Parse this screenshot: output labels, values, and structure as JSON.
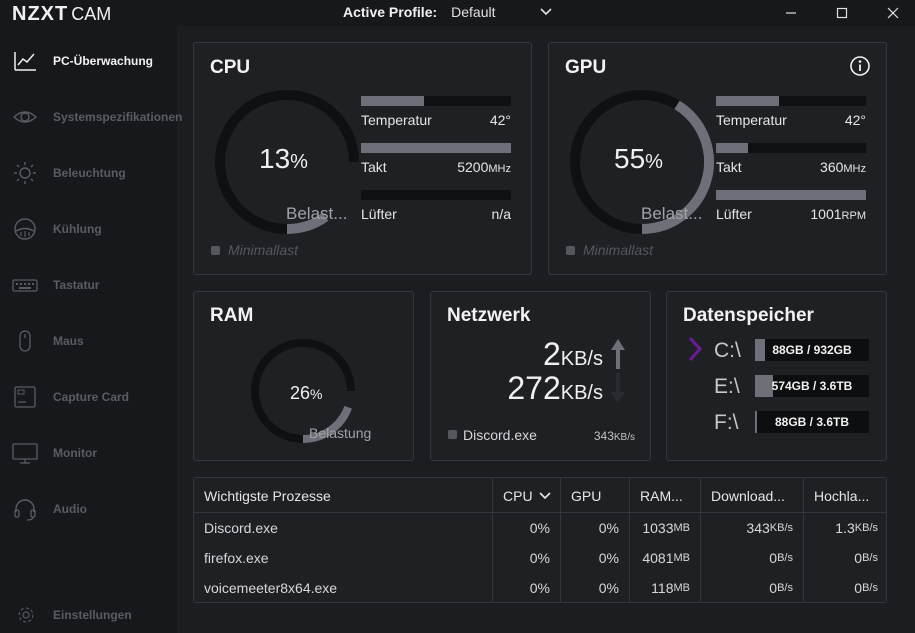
{
  "app": {
    "logo_main": "NZXT",
    "logo_sub": "CAM"
  },
  "header": {
    "profile_label": "Active Profile:",
    "profile_value": "Default"
  },
  "sidebar": {
    "items": [
      {
        "label": "PC-Überwachung",
        "icon": "line-chart-icon",
        "active": true
      },
      {
        "label": "Systemspezifikationen",
        "icon": "eye-icon"
      },
      {
        "label": "Beleuchtung",
        "icon": "sun-icon"
      },
      {
        "label": "Kühlung",
        "icon": "cooler-icon"
      },
      {
        "label": "Tastatur",
        "icon": "keyboard-icon"
      },
      {
        "label": "Maus",
        "icon": "mouse-icon"
      },
      {
        "label": "Capture Card",
        "icon": "capture-card-icon"
      },
      {
        "label": "Monitor",
        "icon": "monitor-icon"
      },
      {
        "label": "Audio",
        "icon": "headset-icon"
      }
    ],
    "settings_label": "Einstellungen"
  },
  "cpu": {
    "title": "CPU",
    "load_value": "13",
    "load_unit": "%",
    "load_fraction": 0.13,
    "load_label": "Belast...",
    "minimal_label": "Minimallast",
    "stats": [
      {
        "label": "Temperatur",
        "value": "42",
        "unit": "°",
        "fill": 0.42
      },
      {
        "label": "Takt",
        "value": "5200",
        "unit": "MHz",
        "fill": 1.0
      },
      {
        "label": "Lüfter",
        "value": "n/a",
        "unit": "",
        "fill": 0.0
      }
    ]
  },
  "gpu": {
    "title": "GPU",
    "load_value": "55",
    "load_unit": "%",
    "load_fraction": 0.55,
    "load_label": "Belast...",
    "minimal_label": "Minimallast",
    "stats": [
      {
        "label": "Temperatur",
        "value": "42",
        "unit": "°",
        "fill": 0.42
      },
      {
        "label": "Takt",
        "value": "360",
        "unit": "MHz",
        "fill": 0.21
      },
      {
        "label": "Lüfter",
        "value": "1001",
        "unit": "RPM",
        "fill": 1.0
      }
    ]
  },
  "ram": {
    "title": "RAM",
    "load_value": "26",
    "load_unit": "%",
    "load_fraction": 0.26,
    "load_label": "Belastung"
  },
  "network": {
    "title": "Netzwerk",
    "upload_value": "2",
    "download_value": "272",
    "unit": "KB/s",
    "top_process": "Discord.exe",
    "top_process_value": "343",
    "top_process_unit": "KB/s"
  },
  "storage": {
    "title": "Datenspeicher",
    "drives": [
      {
        "letter": "C:\\",
        "usage": "88GB / 932GB",
        "fill": 0.09,
        "selected": true
      },
      {
        "letter": "E:\\",
        "usage": "574GB / 3.6TB",
        "fill": 0.16
      },
      {
        "letter": "F:\\",
        "usage": "88GB / 3.6TB",
        "fill": 0.02
      }
    ]
  },
  "processes": {
    "columns": [
      "Wichtigste Prozesse",
      "CPU",
      "GPU",
      "RAM...",
      "Download...",
      "Hochla..."
    ],
    "rows": [
      {
        "name": "Discord.exe",
        "cpu": "0%",
        "gpu": "0%",
        "ram": "1033",
        "ram_unit": "MB",
        "down": "343",
        "down_unit": "KB/s",
        "up": "1.3",
        "up_unit": "KB/s"
      },
      {
        "name": "firefox.exe",
        "cpu": "0%",
        "gpu": "0%",
        "ram": "4081",
        "ram_unit": "MB",
        "down": "0",
        "down_unit": "B/s",
        "up": "0",
        "up_unit": "B/s"
      },
      {
        "name": "voicemeeter8x64.exe",
        "cpu": "0%",
        "gpu": "0%",
        "ram": "118",
        "ram_unit": "MB",
        "down": "0",
        "down_unit": "B/s",
        "up": "0",
        "up_unit": "B/s"
      }
    ]
  },
  "colors": {
    "background": "#1c1d21",
    "sidebar": "#17181b",
    "card": "#1f2024",
    "gauge_fill": "#6e6f78",
    "accent": "#6a1b9a"
  }
}
